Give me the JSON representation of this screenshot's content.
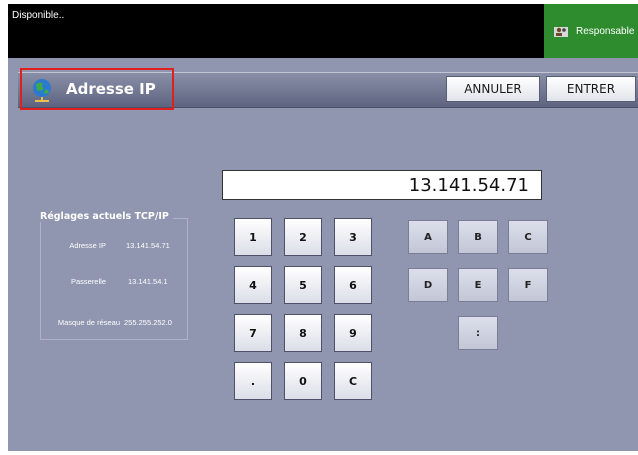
{
  "status": {
    "text": "Disponible.."
  },
  "user": {
    "label": "Responsable",
    "icon": "user-icon"
  },
  "header": {
    "title": "Adresse IP",
    "icon": "network-globe-icon"
  },
  "actions": {
    "cancel": "ANNULER",
    "enter": "ENTRER"
  },
  "ip_display": {
    "value": "13.141.54.71"
  },
  "tcp_settings": {
    "title": "Réglages actuels TCP/IP",
    "rows": [
      {
        "label": "Adresse IP",
        "value": "13.141.54.71"
      },
      {
        "label": "Passerelle",
        "value": "13.141.54.1"
      },
      {
        "label": "Masque de réseau",
        "value": "255.255.252.0"
      }
    ]
  },
  "keypad": {
    "keys": [
      "1",
      "2",
      "3",
      "4",
      "5",
      "6",
      "7",
      "8",
      "9",
      ".",
      "0",
      "C"
    ]
  },
  "hexpad": {
    "keys": [
      "A",
      "B",
      "C",
      "D",
      "E",
      "F",
      ":"
    ]
  },
  "colors": {
    "status_bar": "#000000",
    "user_button": "#2e8b2e",
    "background": "#9096b0",
    "highlight": "#e0201c"
  }
}
